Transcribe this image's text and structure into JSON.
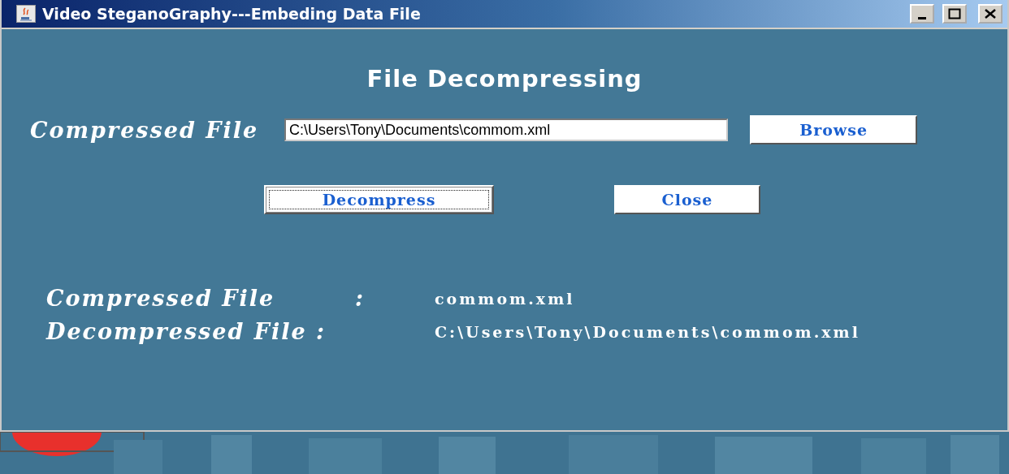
{
  "window": {
    "title": "Video SteganoGraphy---Embeding Data File"
  },
  "heading": "File Decompressing",
  "file_row": {
    "label": "Compressed File",
    "value": "C:\\Users\\Tony\\Documents\\commom.xml",
    "button": "Browse"
  },
  "actions": [
    {
      "label": "Decompress",
      "focused": true
    },
    {
      "label": "Close",
      "focused": false
    }
  ],
  "info": [
    {
      "label": "Compressed File",
      "separator": ":",
      "value": "commom.xml"
    },
    {
      "label": "Decompressed File :",
      "value": "C:\\Users\\Tony\\Documents\\commom.xml"
    }
  ]
}
